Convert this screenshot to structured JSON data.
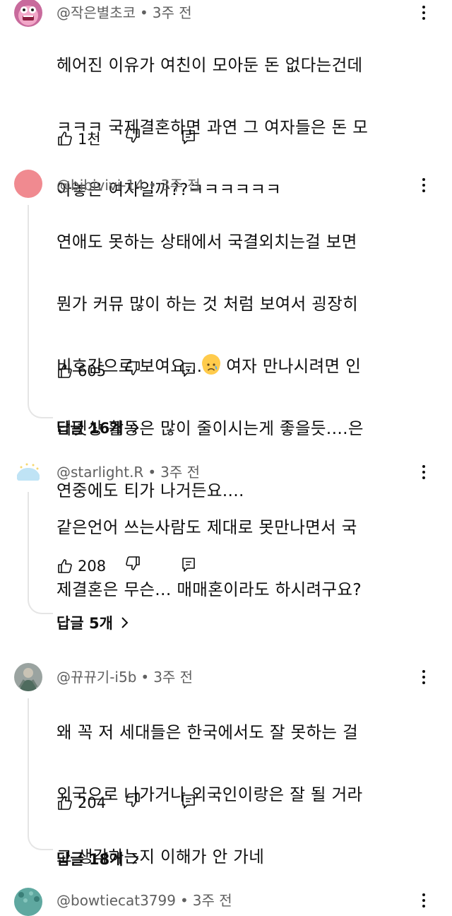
{
  "comments": [
    {
      "handle": "@작은별초코",
      "time": "3주 전",
      "lines": [
        "헤어진 이유가 여친이 모아둔 돈 없다는건데",
        "ㅋㅋㅋ 국제결혼하면 과연 그 여자들은 돈 모",
        "아놓은 여자일까??ㅋㅋㅋㅋㅋㅋ"
      ],
      "likes": "1천",
      "replies": ""
    },
    {
      "handle": "@bibivivi-14",
      "time": "3주 전",
      "lines": [
        "연애도 못하는 상태에서 국결외치는걸 보면",
        "뭔가 커뮤 많이 하는 것 처럼 보여서 굉장히",
        "비호감으로 보여요...",
        "터넷상 활동은 많이 줄이시는게 좋을듯....은",
        "연중에도 티가 나거든요...."
      ],
      "line3_after_emoji": " 여자 만나시려면 인",
      "likes": "605",
      "replies": "답글 16개"
    },
    {
      "handle": "@starlight.R",
      "time": "3주 전",
      "lines": [
        "같은언어 쓰는사람도 제대로 못만나면서 국",
        "제결혼은 무슨... 매매혼이라도 하시려구요?"
      ],
      "likes": "208",
      "replies": "답글 5개"
    },
    {
      "handle": "@뀨뀨기-i5b",
      "time": "3주 전",
      "lines": [
        "왜 꼭 저 세대들은 한국에서도 잘 못하는 걸",
        "외국으로 나가거나 외국인이랑은 잘 될 거라",
        "고 생각하는지 이해가 안 가네"
      ],
      "likes": "204",
      "replies": "답글 18개"
    },
    {
      "handle": "@bowtiecat3799",
      "time": "3주 전"
    }
  ],
  "meta_separator": "•",
  "icons": {
    "like": "thumbs-up-icon",
    "dislike": "thumbs-down-icon",
    "reply": "reply-comment-icon",
    "more": "more-vertical-icon",
    "chevron": "chevron-right-icon",
    "emoji": "sad-face-emoji-icon"
  },
  "colors": {
    "meta": "#606060",
    "text": "#0f0f0f",
    "thread": "#e5e5e5",
    "avatar2": "#f08a90"
  }
}
